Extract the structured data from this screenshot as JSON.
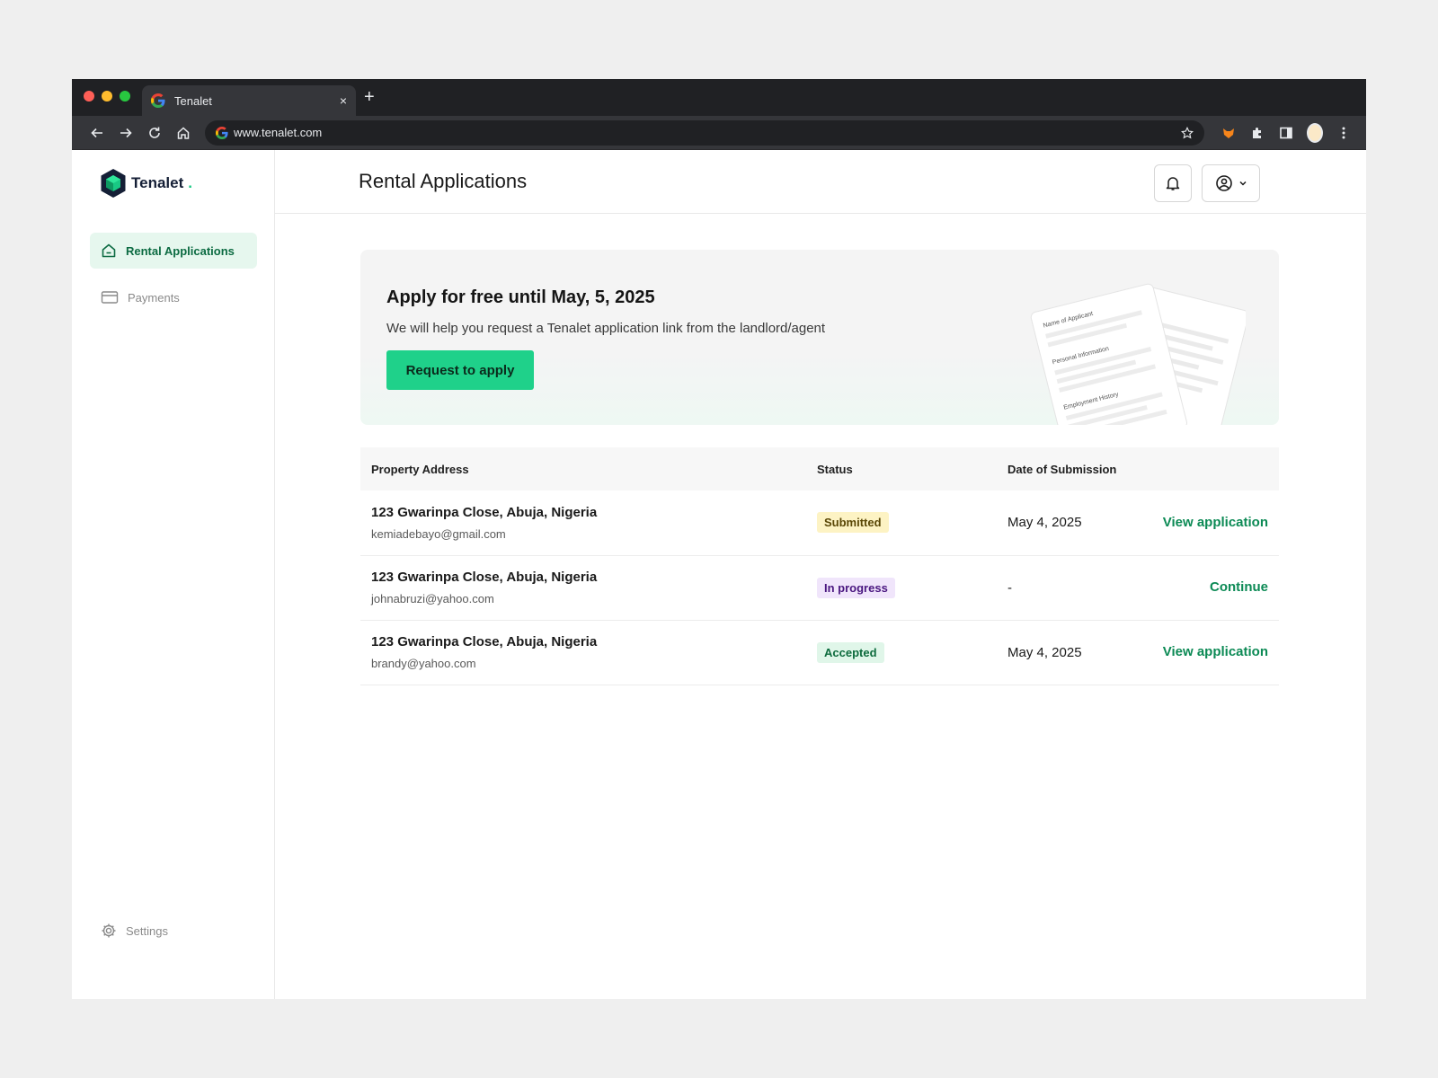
{
  "browser": {
    "tab_title": "Tenalet",
    "tab_close": "×",
    "new_tab": "+",
    "url": "www.tenalet.com"
  },
  "sidebar": {
    "brand_name": "Tenalet",
    "brand_dot": ".",
    "items": [
      {
        "label": "Rental Applications",
        "icon": "home-icon",
        "active": true
      },
      {
        "label": "Payments",
        "icon": "credit-card-icon",
        "active": false
      }
    ],
    "settings_label": "Settings"
  },
  "header": {
    "title": "Rental Applications"
  },
  "banner": {
    "heading": "Apply for free until May, 5, 2025",
    "description": "We will help you request a Tenalet application link from the landlord/agent",
    "cta_label": "Request to apply",
    "illustration": {
      "field1": "Name of Applicant",
      "field2": "Personal Information",
      "field3": "Employment History"
    }
  },
  "table": {
    "columns": [
      "Property Address",
      "Status",
      "Date of Submission",
      ""
    ],
    "rows": [
      {
        "address": "123 Gwarinpa Close, Abuja, Nigeria",
        "email": "kemiadebayo@gmail.com",
        "status": "Submitted",
        "date": "May 4, 2025",
        "action": "View application"
      },
      {
        "address": "123 Gwarinpa Close, Abuja, Nigeria",
        "email": "johnabruzi@yahoo.com",
        "status": "In progress",
        "date": "-",
        "action": "Continue"
      },
      {
        "address": "123 Gwarinpa Close, Abuja, Nigeria",
        "email": "brandy@yahoo.com",
        "status": "Accepted",
        "date": "May 4, 2025",
        "action": "View application"
      }
    ]
  },
  "colors": {
    "brand_green": "#1fd18a",
    "link_green": "#0c8a55",
    "active_nav_bg": "#e6f7ee",
    "brand_navy": "#151f36"
  }
}
